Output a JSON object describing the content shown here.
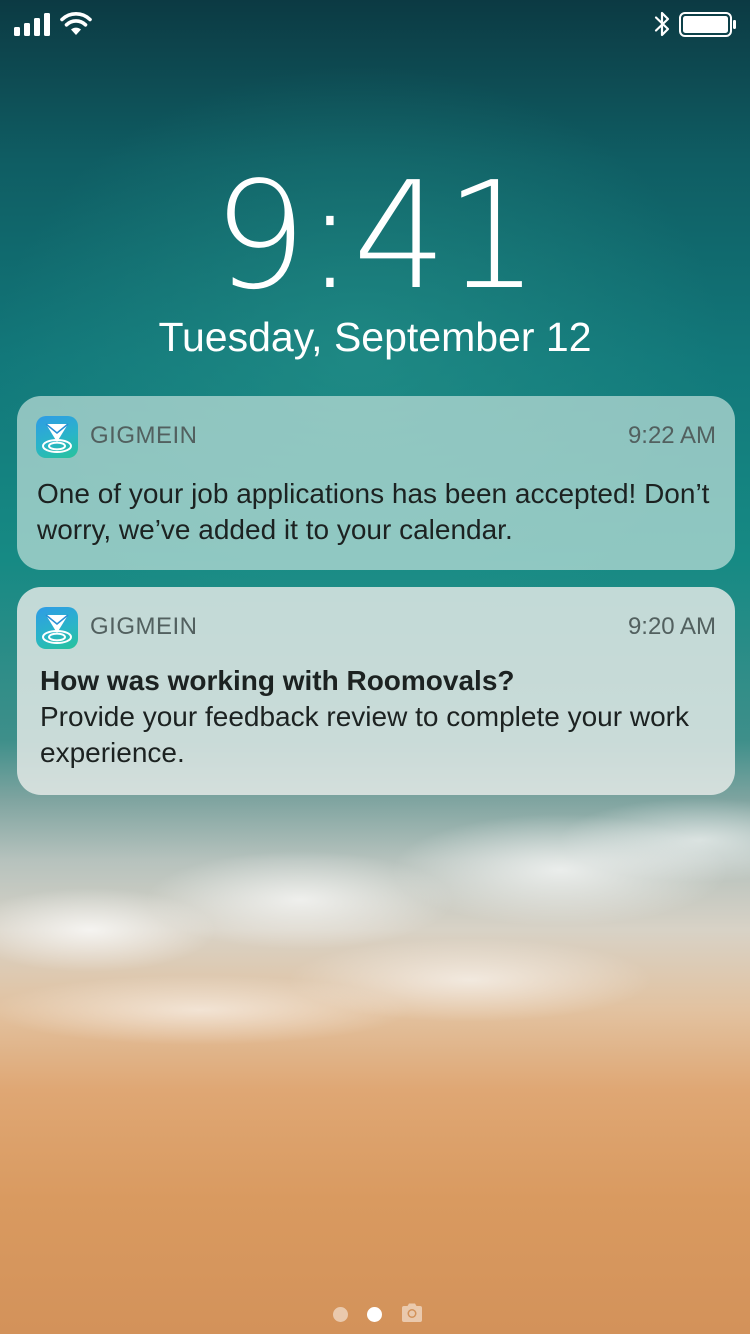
{
  "status_bar": {
    "signal_icon": "cellular-signal-icon",
    "wifi_icon": "wifi-icon",
    "bluetooth_icon": "bluetooth-icon",
    "battery_icon": "battery-icon"
  },
  "lock_screen": {
    "time": "9:41",
    "date": "Tuesday, September 12"
  },
  "notifications": [
    {
      "app_name": "GIGMEIN",
      "time": "9:22 AM",
      "title": "",
      "body": "One of your job applications has been accepted! Don’t worry, we’ve added it to your calendar."
    },
    {
      "app_name": "GIGMEIN",
      "time": "9:20 AM",
      "title": "How was working with Roomovals?",
      "body": "Provide your feedback review to complete your work experience."
    }
  ],
  "page_indicator": {
    "pages": 2,
    "current": 2,
    "camera_icon": "camera-icon"
  },
  "colors": {
    "app_icon_start": "#2f9be6",
    "app_icon_end": "#27c39a",
    "text_primary": "#1c2221",
    "text_secondary": "#52605f"
  }
}
